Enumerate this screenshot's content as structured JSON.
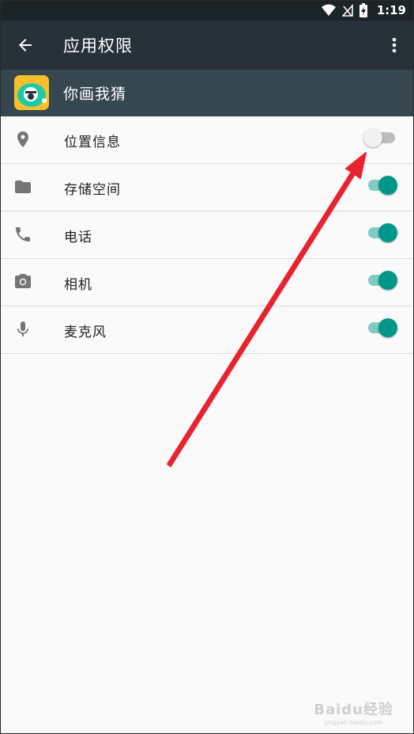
{
  "status_bar": {
    "time": "1:19",
    "icons": [
      "wifi-icon",
      "no-signal-icon",
      "battery-charging-icon"
    ]
  },
  "app_bar": {
    "title": "应用权限",
    "back_icon": "arrow-back-icon",
    "menu_icon": "more-vert-icon"
  },
  "header": {
    "app_name": "你画我猜",
    "app_icon": "app-icon"
  },
  "permissions": [
    {
      "label": "位置信息",
      "icon": "location-icon",
      "enabled": false
    },
    {
      "label": "存储空间",
      "icon": "folder-icon",
      "enabled": true
    },
    {
      "label": "电话",
      "icon": "phone-icon",
      "enabled": true
    },
    {
      "label": "相机",
      "icon": "camera-icon",
      "enabled": true
    },
    {
      "label": "麦克风",
      "icon": "mic-icon",
      "enabled": true
    }
  ],
  "annotation": {
    "color": "#e8232f",
    "target": "location-toggle"
  },
  "watermark": {
    "main": "Baidu经验",
    "sub": "jingyan.baidu.com"
  },
  "colors": {
    "status_bar": "#1b2426",
    "app_bar": "#263238",
    "header": "#37474f",
    "switch_on": "#009688",
    "switch_off": "#f1f1f1"
  }
}
